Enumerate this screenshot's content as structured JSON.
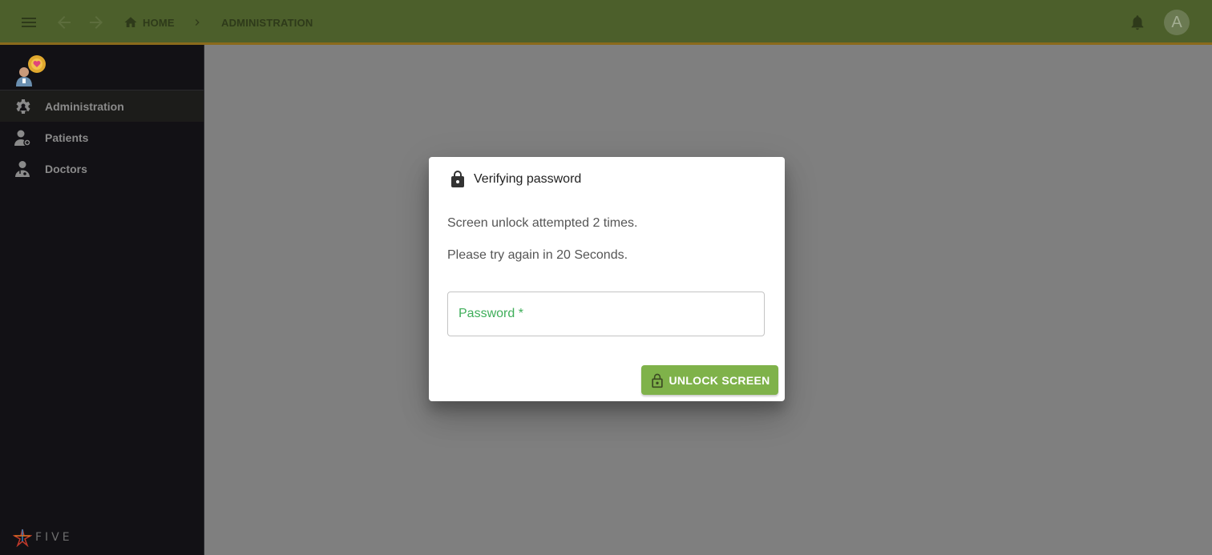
{
  "topbar": {
    "breadcrumb_home": "HOME",
    "breadcrumb_separator": "›",
    "breadcrumb_current": "ADMINISTRATION",
    "avatar_initial": "A",
    "icons": [
      "menu-icon",
      "arrow-back-icon",
      "arrow-forward-icon",
      "home-icon",
      "bell-icon"
    ]
  },
  "sidebar": {
    "items": [
      {
        "label": "Administration",
        "icon": "gear-person-icon",
        "active": true
      },
      {
        "label": "Patients",
        "icon": "patient-icon",
        "active": false
      },
      {
        "label": "Doctors",
        "icon": "doctor-icon",
        "active": false
      }
    ],
    "footer_logo": "FIVE"
  },
  "dialog": {
    "title": "Verifying password",
    "message_line1": "Screen unlock attempted 2 times.",
    "message_line2": "Please try again in 20 Seconds.",
    "password_label": "Password *",
    "unlock_button": "UNLOCK SCREEN"
  },
  "colors": {
    "topbar_bg": "#4c5f2b",
    "topbar_border": "#8a6a1c",
    "sidebar_bg": "#121115",
    "overlay_bg": "#7f7f7f",
    "accent_green": "#7fb24a",
    "label_green": "#3fae5a"
  }
}
